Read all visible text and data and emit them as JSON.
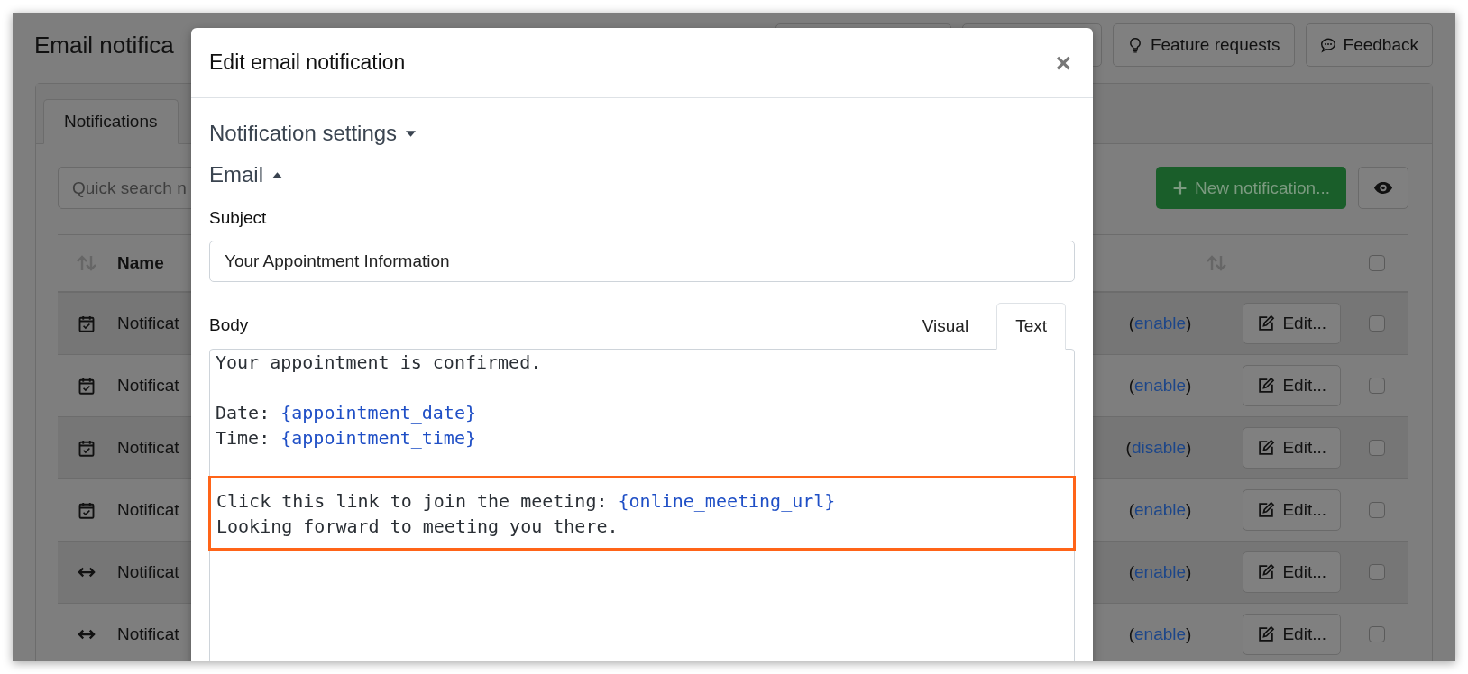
{
  "page": {
    "title": "Email notifica",
    "toolbar": [
      {
        "kind": "blank"
      },
      {
        "kind": "blank"
      },
      {
        "label": "Feature requests",
        "kind": "bulb"
      },
      {
        "label": "Feedback",
        "kind": "chat"
      }
    ]
  },
  "tabs": [
    {
      "label": "Notifications",
      "selected": true
    }
  ],
  "search": {
    "placeholder": "Quick search n"
  },
  "new_button": "New notification...",
  "table": {
    "header_name": "Name",
    "rows": [
      {
        "kind": "calendar",
        "name": "Notificat",
        "status": [
          {
            "text": "(",
            "kind": "plain"
          },
          {
            "text": "enable",
            "kind": "link"
          },
          {
            "text": ")",
            "kind": "plain"
          }
        ],
        "edit": "Edit...",
        "checked": false
      },
      {
        "kind": "calendar",
        "name": "Notificat",
        "status": [
          {
            "text": "(",
            "kind": "plain"
          },
          {
            "text": "enable",
            "kind": "link"
          },
          {
            "text": ")",
            "kind": "plain"
          }
        ],
        "edit": "Edit...",
        "checked": false
      },
      {
        "kind": "calendar",
        "name": "Notificat",
        "status": [
          {
            "text": "(",
            "kind": "plain"
          },
          {
            "text": "disable",
            "kind": "link"
          },
          {
            "text": ")",
            "kind": "plain"
          }
        ],
        "edit": "Edit...",
        "checked": false
      },
      {
        "kind": "calendar",
        "name": "Notificat",
        "status": [
          {
            "text": "(",
            "kind": "plain"
          },
          {
            "text": "enable",
            "kind": "link"
          },
          {
            "text": ")",
            "kind": "plain"
          }
        ],
        "edit": "Edit...",
        "checked": false
      },
      {
        "kind": "arrows",
        "name": "Notificat",
        "status": [
          {
            "text": "(",
            "kind": "plain"
          },
          {
            "text": "enable",
            "kind": "link"
          },
          {
            "text": ")",
            "kind": "plain"
          }
        ],
        "edit": "Edit...",
        "checked": false
      },
      {
        "kind": "arrows",
        "name": "Notificat",
        "status": [
          {
            "text": "(",
            "kind": "plain"
          },
          {
            "text": "enable",
            "kind": "link"
          },
          {
            "text": ")",
            "kind": "plain"
          }
        ],
        "edit": "Edit...",
        "checked": false
      }
    ],
    "header_checked": false
  },
  "modal": {
    "title": "Edit email notification",
    "close": "×",
    "sections": [
      {
        "label": "Notification settings",
        "expanded": false
      },
      {
        "label": "Email",
        "expanded": true
      }
    ],
    "subject_label": "Subject",
    "subject": "Your Appointment Information",
    "body_label": "Body",
    "body_tabs": [
      {
        "label": "Visual",
        "selected": false
      },
      {
        "label": "Text",
        "selected": true
      }
    ],
    "body_blocks": [
      {
        "highlighted": false,
        "lines": [
          [
            {
              "text": "Your appointment is confirmed.",
              "kind": "plain"
            }
          ]
        ]
      },
      {
        "highlighted": false,
        "lines": [
          [
            {
              "text": "Date: ",
              "kind": "plain"
            },
            {
              "text": "{appointment_date}",
              "kind": "placeholder"
            }
          ],
          [
            {
              "text": "Time: ",
              "kind": "plain"
            },
            {
              "text": "{appointment_time}",
              "kind": "placeholder"
            }
          ]
        ]
      },
      {
        "highlighted": true,
        "lines": [
          [
            {
              "text": "Click this link to join the meeting: ",
              "kind": "plain"
            },
            {
              "text": "{online_meeting_url}",
              "kind": "placeholder"
            }
          ],
          [
            {
              "text": "Looking forward to meeting you there.",
              "kind": "plain"
            }
          ]
        ]
      }
    ]
  }
}
